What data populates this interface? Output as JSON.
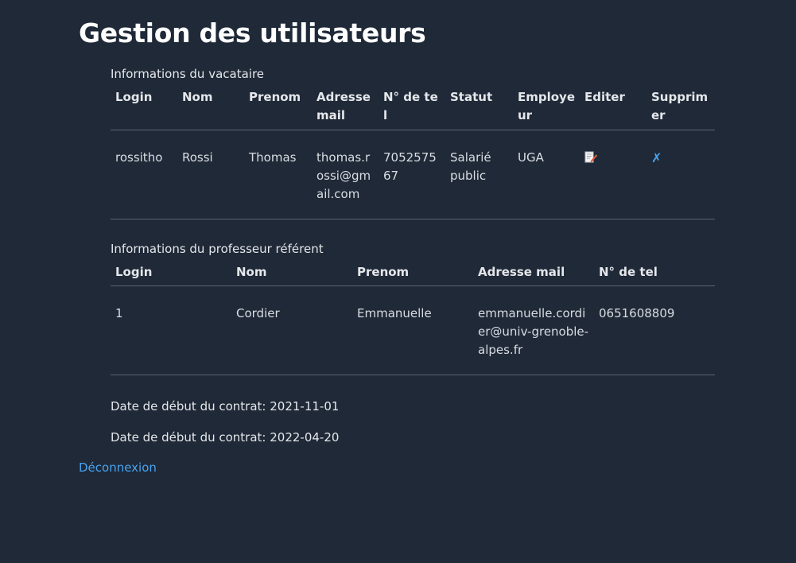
{
  "page_title": "Gestion des utilisateurs",
  "vacataire": {
    "caption": "Informations du vacataire",
    "headers": [
      "Login",
      "Nom",
      "Prenom",
      "Adresse mail",
      "N° de tel",
      "Statut",
      "Employeur",
      "Editer",
      "Supprimer"
    ],
    "row": {
      "login": "rossitho",
      "nom": "Rossi",
      "prenom": "Thomas",
      "mail": "thomas.rossi@gmail.com",
      "tel": "705257567",
      "statut": "Salarié public",
      "employeur": "UGA",
      "edit_icon": "edit-document-icon",
      "delete_label": "✗"
    }
  },
  "referent": {
    "caption": "Informations du professeur référent",
    "headers": [
      "Login",
      "Nom",
      "Prenom",
      "Adresse mail",
      "N° de tel"
    ],
    "row": {
      "login": "1",
      "nom": "Cordier",
      "prenom": "Emmanuelle",
      "mail": "emmanuelle.cordier@univ-grenoble-alpes.fr",
      "tel": "0651608809"
    }
  },
  "contract": {
    "start_line": "Date de début du contrat: 2021-11-01",
    "end_line": "Date de début du contrat: 2022-04-20"
  },
  "logout_label": "Déconnexion",
  "colors": {
    "background": "#1f2937",
    "link": "#4aa3f0"
  }
}
